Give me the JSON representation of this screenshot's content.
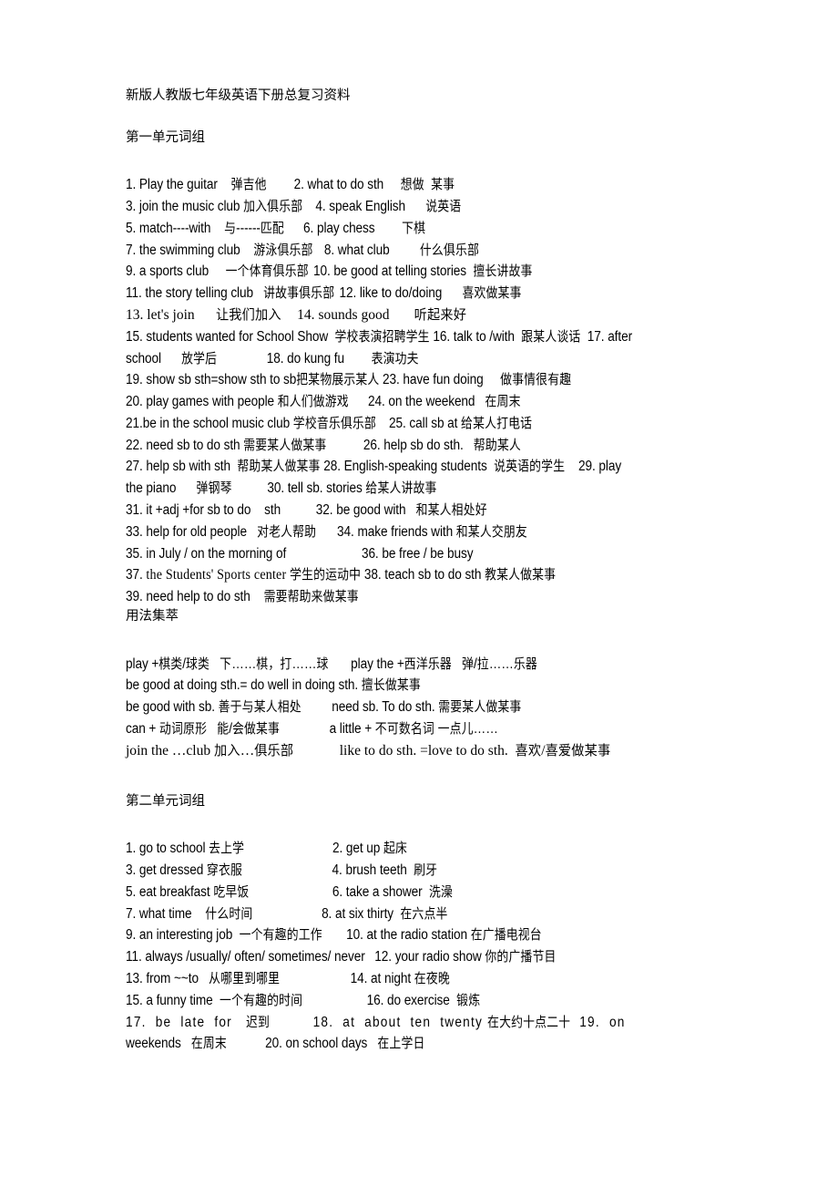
{
  "document": {
    "title": "新版人教版七年级英语下册总复习资料",
    "unit1_heading": "第一单元词组",
    "usage_heading": "用法集萃",
    "unit2_heading": "第二单元词组"
  },
  "unit1_phrases": [
    {
      "left": "1. Play the guitar    弹吉他",
      "right": "2. what to do sth     想做  某事",
      "pad": 34
    },
    {
      "left": "3. join the music club 加入俱乐部",
      "right": "4. speak English      说英语",
      "pad": 16
    },
    {
      "left": "5. match----with    与------匹配",
      "right": "6. play chess        下棋",
      "pad": 24
    },
    {
      "left": "7. the swimming club    游泳俱乐部",
      "right": "8. what club         什么俱乐部",
      "pad": 14
    },
    {
      "left": "9. a sports club     一个体育俱乐部",
      "right": "10. be good at telling stories  擅长讲故事",
      "pad": 6
    },
    {
      "left": "11. the story telling club   讲故事俱乐部",
      "right": "12. like to do/doing      喜欢做某事",
      "pad": 6
    },
    {
      "left": "13. let's join      让我们加入",
      "right": "14. sounds good       听起来好",
      "pad": 18,
      "serif_left": true
    },
    {
      "left": "15. students wanted for School Show  学校表演招聘学生 16. talk to /with  跟某人谈话  17. after",
      "right": "",
      "pad": 0
    },
    {
      "left": "school      放学后",
      "right": "18. do kung fu        表演功夫",
      "pad": 62
    },
    {
      "left": "19. show sb sth=show sth to sb把某物展示某人",
      "right": "23. have fun doing     做事情很有趣",
      "pad": 4
    },
    {
      "left": "20. play games with people 和人们做游戏",
      "right": "24. on the weekend   在周末",
      "pad": 24
    },
    {
      "left": "21.be in the school music club 学校音乐俱乐部",
      "right": "25. call sb at 给某人打电话",
      "pad": 16
    },
    {
      "left": "22. need sb to do sth 需要某人做某事",
      "right": "26. help sb do sth.   帮助某人",
      "pad": 46
    },
    {
      "left": "27. help sb with sth  帮助某人做某事 28. English-speaking students  说英语的学生    29. play",
      "right": "",
      "pad": 0
    },
    {
      "left": "the piano      弹钢琴",
      "right": "30. tell sb. stories 给某人讲故事",
      "pad": 44
    },
    {
      "left": "31. it +adj +for sb to do    sth",
      "right": "32. be good with   和某人相处好",
      "pad": 44
    },
    {
      "left": "33. help for old people   对老人帮助",
      "right": "34. make friends with 和某人交朋友",
      "pad": 26
    },
    {
      "left": "35. in July / on the morning of",
      "right": "36. be free / be busy",
      "pad": 94
    },
    {
      "left": "37. the Students' Sports center 学生的运动中 38. teach sb to do sth 教某人做某事",
      "right": "",
      "pad": 0,
      "serif_run": "the Students' Sports center"
    },
    {
      "left": "39. need help to do sth    需要帮助来做某事",
      "right": "",
      "pad": 0
    }
  ],
  "usage_lines": [
    {
      "left": "play +棋类/球类   下……棋，打……球",
      "right": "play the +西洋乐器   弹/拉……乐器",
      "pad": 28
    },
    {
      "left": "be good at doing sth.= do well in doing sth. 擅长做某事",
      "right": "",
      "pad": 0
    },
    {
      "left": "be good with sb. 善于与某人相处",
      "right": "need sb. To do sth. 需要某人做某事",
      "pad": 38
    },
    {
      "left": "can + 动词原形   能/会做某事",
      "right": "a little + 不可数名词 一点儿……",
      "pad": 62
    },
    {
      "left": "join the …club 加入…俱乐部",
      "right": "like to do sth. =love to do sth.  喜欢/喜爱做某事",
      "pad": 52,
      "serif_left": true
    }
  ],
  "unit2_phrases": [
    {
      "left": "1. go to school 去上学",
      "right": "2. get up 起床",
      "pad": 110
    },
    {
      "left": "3. get dressed 穿衣服",
      "right": "4. brush teeth  刷牙",
      "pad": 112
    },
    {
      "left": "5. eat breakfast 吃早饭",
      "right": "6. take a shower  洗澡",
      "pad": 104
    },
    {
      "left": "7. what time    什么时间",
      "right": "8. at six thirty  在六点半",
      "pad": 86
    },
    {
      "left": "9. an interesting job  一个有趣的工作",
      "right": "10. at the radio station 在广播电视台",
      "pad": 30
    },
    {
      "left": "11. always /usually/ often/ sometimes/ never",
      "right": "12. your radio show 你的广播节目",
      "pad": 12
    },
    {
      "left": "13. from ~~to   从哪里到哪里",
      "right": "14. at night 在夜晚",
      "pad": 88
    },
    {
      "left": "15. a funny time  一个有趣的时间",
      "right": "16. do exercise  锻炼",
      "pad": 80
    },
    {
      "left": "17.  be  late  for   迟到",
      "right": "18.  at  about  ten  twenty 在大约十点二十  19.  on",
      "pad": 54,
      "wide": true
    },
    {
      "left": "weekends   在周末",
      "right": "20. on school days   在上学日",
      "pad": 48
    }
  ]
}
